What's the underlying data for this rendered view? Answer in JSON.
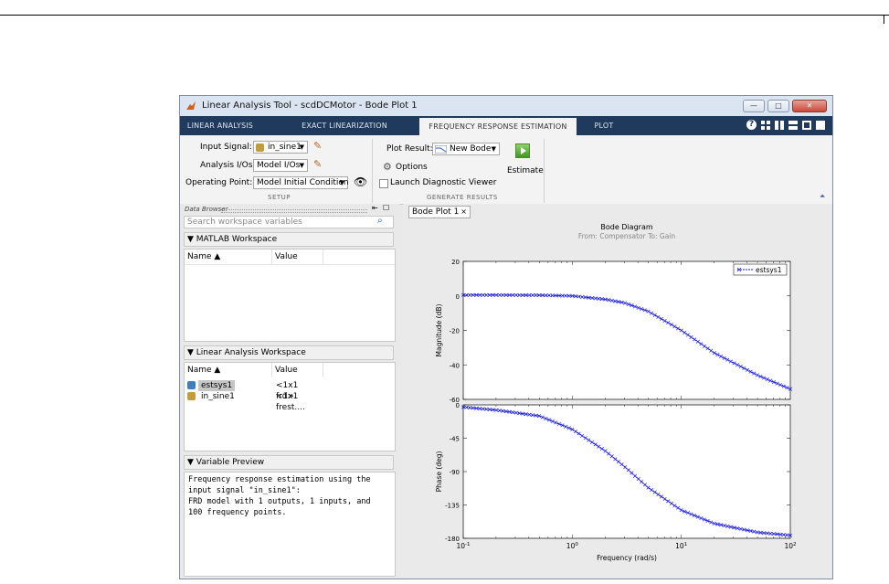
{
  "window": {
    "title": "Linear Analysis Tool - scdDCMotor - Bode Plot 1",
    "buttons": [
      "minimize-button",
      "maximize-button",
      "close-button"
    ]
  },
  "tabs": [
    "LINEAR ANALYSIS",
    "EXACT LINEARIZATION",
    "FREQUENCY RESPONSE ESTIMATION",
    "PLOT"
  ],
  "ribbon": {
    "setup": {
      "input_signal_label": "Input Signal:",
      "input_signal_value": "in_sine1",
      "analysis_ios_label": "Analysis I/Os:",
      "analysis_ios_value": "Model I/Os",
      "operating_point_label": "Operating Point:",
      "operating_point_value": "Model Initial Condition",
      "section_label": "SETUP"
    },
    "generate": {
      "plot_result_label": "Plot Result:",
      "plot_result_value": "New Bode",
      "options_label": "Options",
      "launch_label": "Launch Diagnostic Viewer",
      "estimate_label": "Estimate",
      "section_label": "GENERATE RESULTS"
    }
  },
  "data_browser": {
    "title": "Data Browser",
    "search_placeholder": "Search workspace variables",
    "matlab_workspace": {
      "title": "MATLAB Workspace",
      "columns": [
        "Name ▲",
        "Value"
      ]
    },
    "linear_workspace": {
      "title": "Linear Analysis Workspace",
      "columns": [
        "Name ▲",
        "Value"
      ],
      "rows": [
        {
          "name": "estsys1",
          "value": "<1x1 frd>"
        },
        {
          "name": "in_sine1",
          "value": "<1x1 frest...."
        }
      ]
    },
    "variable_preview": {
      "title": "Variable Preview",
      "text": "Frequency response estimation using the\ninput signal \"in_sine1\":\nFRD model with 1 outputs, 1 inputs, and\n100 frequency points."
    }
  },
  "document_tab": "Bode Plot 1",
  "chart_data": {
    "type": "line",
    "title": "Bode Diagram",
    "subtitle": "From: Compensator  To: Gain",
    "xlabel": "Frequency  (rad/s)",
    "xscale": "log",
    "xlim": [
      0.1,
      100
    ],
    "x_ticks": [
      "10^-1",
      "10^0",
      "10^1",
      "10^2"
    ],
    "legend": "estsys1",
    "legend_position": "top-right",
    "series_color": "#1a1aee",
    "panels": [
      {
        "ylabel": "Magnitude (dB)",
        "ylim": [
          -60,
          20
        ],
        "y_ticks": [
          20,
          0,
          -20,
          -40,
          -60
        ],
        "x": [
          0.1,
          0.2,
          0.5,
          1,
          2,
          3,
          5,
          10,
          20,
          50,
          100
        ],
        "y": [
          0.5,
          0.5,
          0.4,
          0,
          -2,
          -4,
          -9,
          -20,
          -33,
          -46,
          -54
        ]
      },
      {
        "ylabel": "Phase (deg)",
        "ylim": [
          -180,
          0
        ],
        "y_ticks": [
          0,
          -45,
          -90,
          -135,
          -180
        ],
        "x": [
          0.1,
          0.2,
          0.5,
          1,
          2,
          3,
          5,
          10,
          20,
          50,
          100
        ],
        "y": [
          -3,
          -7,
          -15,
          -33,
          -62,
          -83,
          -112,
          -142,
          -160,
          -172,
          -176
        ]
      }
    ]
  }
}
